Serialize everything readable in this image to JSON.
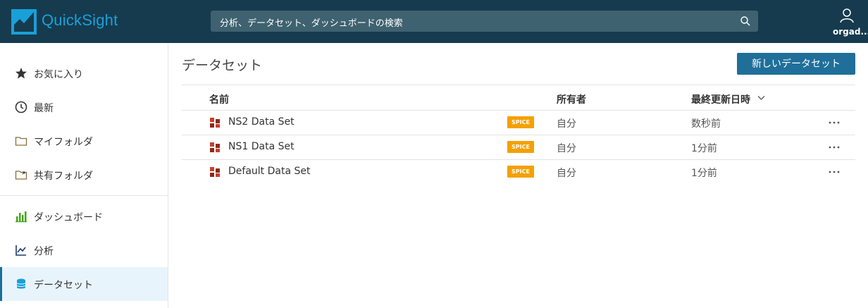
{
  "header": {
    "app_name": "QuickSight",
    "search_placeholder": "分析、データセット、ダッシュボードの検索",
    "user_name": "orgad..."
  },
  "sidebar": {
    "items": [
      {
        "label": "お気に入り",
        "icon": "star-icon"
      },
      {
        "label": "最新",
        "icon": "clock-icon"
      },
      {
        "label": "マイフォルダ",
        "icon": "folder-icon"
      },
      {
        "label": "共有フォルダ",
        "icon": "shared-folder-icon"
      },
      {
        "label": "ダッシュボード",
        "icon": "dashboard-icon"
      },
      {
        "label": "分析",
        "icon": "analysis-icon"
      },
      {
        "label": "データセット",
        "icon": "database-icon",
        "active": true
      }
    ]
  },
  "main": {
    "title": "データセット",
    "new_button": "新しいデータセット",
    "columns": {
      "name": "名前",
      "owner": "所有者",
      "updated": "最終更新日時"
    },
    "rows": [
      {
        "name": "NS2 Data Set",
        "badge": "SPICE",
        "owner": "自分",
        "updated": "数秒前"
      },
      {
        "name": "NS1 Data Set",
        "badge": "SPICE",
        "owner": "自分",
        "updated": "1分前"
      },
      {
        "name": "Default Data Set",
        "badge": "SPICE",
        "owner": "自分",
        "updated": "1分前"
      }
    ]
  },
  "colors": {
    "header_bg": "#163b4f",
    "brand": "#1aa0d8",
    "primary_button": "#1f6f9a",
    "spice_badge": "#f5a000",
    "active_nav_bg": "#e8f4fb"
  }
}
